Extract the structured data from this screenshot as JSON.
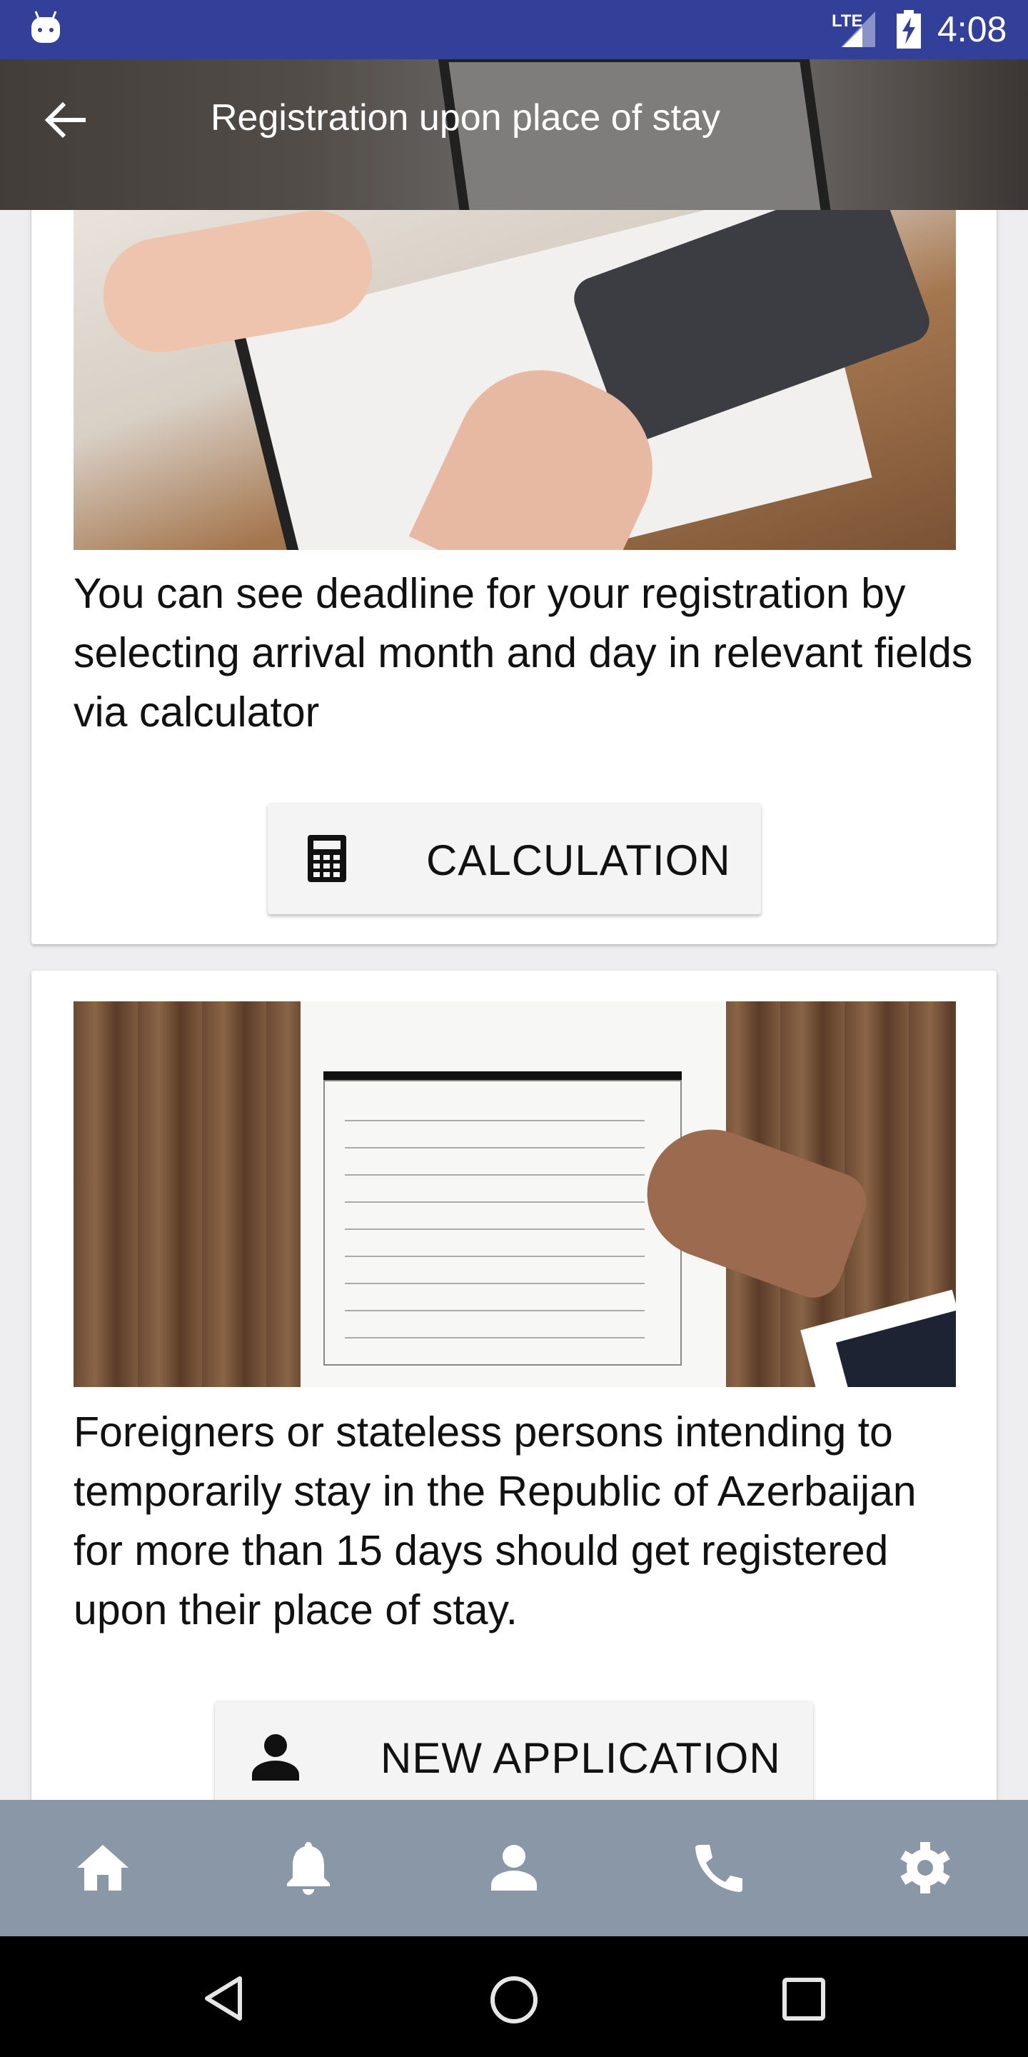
{
  "status_bar": {
    "time": "4:08",
    "network": "LTE",
    "icons": [
      "android-notification-icon",
      "lte-signal-icon",
      "battery-charging-icon"
    ],
    "color": "#33409a"
  },
  "toolbar": {
    "title": "Registration upon place of stay",
    "back_icon": "arrow-left-icon"
  },
  "cards": [
    {
      "text": "You can see deadline for your registration by selecting arrival month and day in relevant fields via calculator",
      "button_label": "CALCULATION",
      "button_icon": "calculator-icon"
    },
    {
      "text": "Foreigners or stateless persons intending to temporarily stay in the Republic of Azerbaijan for more than 15 days should get registered upon their place of stay.",
      "button_label": "NEW APPLICATION",
      "button_icon": "person-icon"
    }
  ],
  "bottom_nav": {
    "color": "#8a97a6",
    "items": [
      "home-icon",
      "bell-icon",
      "person-icon",
      "phone-icon",
      "gear-icon"
    ]
  },
  "system_nav": [
    "back-icon",
    "home-circle-icon",
    "recents-icon"
  ]
}
